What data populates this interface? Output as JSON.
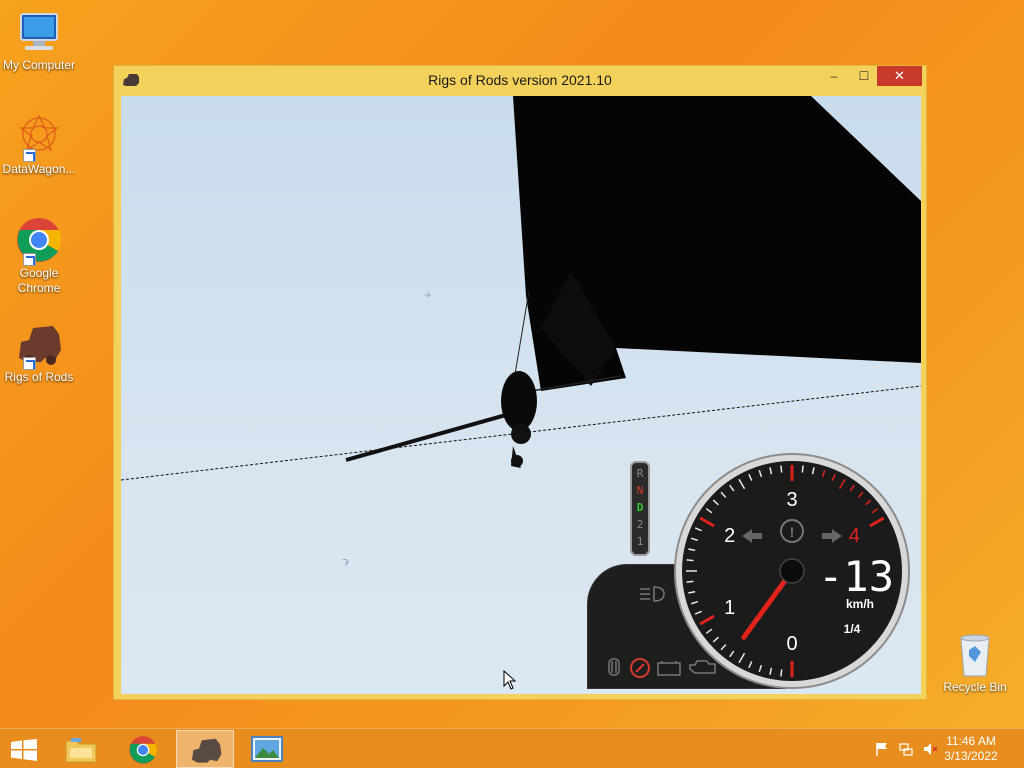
{
  "desktop": {
    "icons": [
      {
        "label": "My Computer",
        "icon": "computer-icon"
      },
      {
        "label": "DataWagon...",
        "icon": "datawagon-icon"
      },
      {
        "label": "Google Chrome",
        "icon": "chrome-icon"
      },
      {
        "label": "Rigs of Rods",
        "icon": "rigs-of-rods-icon"
      },
      {
        "label": "Recycle Bin",
        "icon": "recycle-bin-icon"
      }
    ]
  },
  "window": {
    "title": "Rigs of Rods version 2021.10",
    "controls": {
      "minimize": "–",
      "maximize": "☐",
      "close": "✕"
    }
  },
  "hud": {
    "gears": [
      "R",
      "N",
      "D",
      "2",
      "1"
    ],
    "active_gear": "D",
    "gauge_numbers": [
      "0",
      "1",
      "2",
      "3",
      "4"
    ],
    "speed": "-13",
    "speed_unit": "km/h",
    "gear_ratio": "1/4",
    "needle_rpm_value": 0.6,
    "colors": {
      "redline": "#e0231b",
      "active_gear": "#2ecc2e",
      "neutral_gear": "#d63a2a"
    }
  },
  "taskbar": {
    "items": [
      "start-icon",
      "file-explorer-icon",
      "chrome-icon",
      "rigs-of-rods-icon",
      "image-viewer-icon"
    ],
    "clock_time": "11:46 AM",
    "clock_date": "3/13/2022"
  }
}
